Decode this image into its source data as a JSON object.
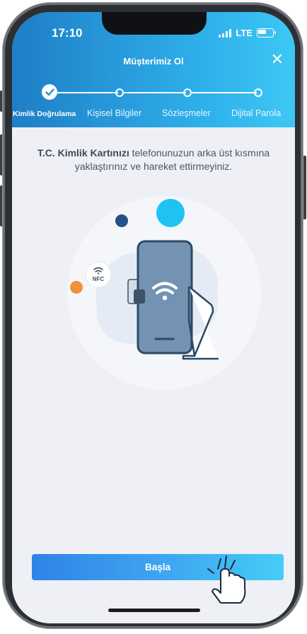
{
  "status_bar": {
    "time": "17:10",
    "network": "LTE"
  },
  "header": {
    "title": "Müşterimiz Ol",
    "close_glyph": "✕"
  },
  "steps": [
    {
      "label": "Kimlik Doğrulama",
      "state": "completed"
    },
    {
      "label": "Kişisel Bilgiler",
      "state": "pending"
    },
    {
      "label": "Sözleşmeler",
      "state": "pending"
    },
    {
      "label": "Dijital Parola",
      "state": "pending"
    }
  ],
  "instruction": {
    "bold": "T.C. Kimlik Kartınızı",
    "rest": " telefonunuzun arka üst kısmına yaklaştırınız ve hareket ettirmeyiniz."
  },
  "illustration": {
    "nfc_label": "NFC"
  },
  "start_button": {
    "label": "Başla"
  },
  "colors": {
    "header_start": "#1f7ec7",
    "header_end": "#3ec7f4",
    "button_start": "#2f83e6",
    "button_end": "#45cdf6",
    "accent_orange": "#f0913a",
    "accent_navy": "#25518a"
  }
}
